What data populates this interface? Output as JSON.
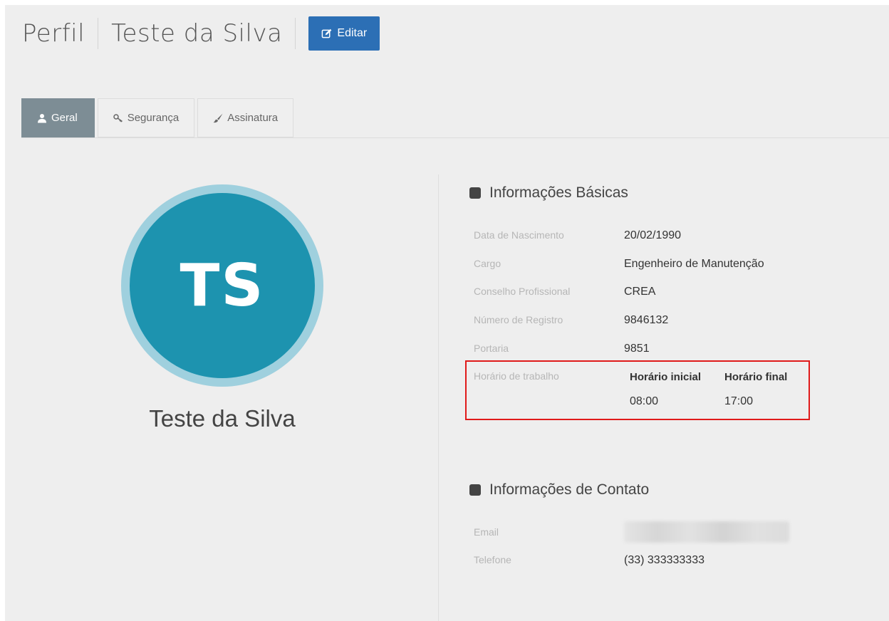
{
  "header": {
    "title": "Perfil",
    "subtitle": "Teste da Silva",
    "edit_label": "Editar"
  },
  "tabs": [
    {
      "label": "Geral",
      "icon": "user-icon",
      "active": true
    },
    {
      "label": "Segurança",
      "icon": "key-icon",
      "active": false
    },
    {
      "label": "Assinatura",
      "icon": "brush-icon",
      "active": false
    }
  ],
  "profile": {
    "initials": "TS",
    "name": "Teste da Silva",
    "avatar_colors": {
      "ring": "#9fd0de",
      "fill": "#1d93af"
    }
  },
  "basic_info": {
    "title": "Informações Básicas",
    "fields": [
      {
        "label": "Data de Nascimento",
        "value": "20/02/1990"
      },
      {
        "label": "Cargo",
        "value": "Engenheiro de Manutenção"
      },
      {
        "label": "Conselho Profissional",
        "value": "CREA"
      },
      {
        "label": "Número de Registro",
        "value": "9846132"
      },
      {
        "label": "Portaria",
        "value": "9851"
      }
    ],
    "work_hours": {
      "label": "Horário de trabalho",
      "start_header": "Horário inicial",
      "end_header": "Horário final",
      "start_value": "08:00",
      "end_value": "17:00",
      "highlight_color": "#e01a1a"
    }
  },
  "contact_info": {
    "title": "Informações de Contato",
    "email_label": "Email",
    "phone_label": "Telefone",
    "phone_value": "(33) 333333333"
  },
  "colors": {
    "accent": "#2c6fb5",
    "active_tab": "#7d8d95"
  }
}
